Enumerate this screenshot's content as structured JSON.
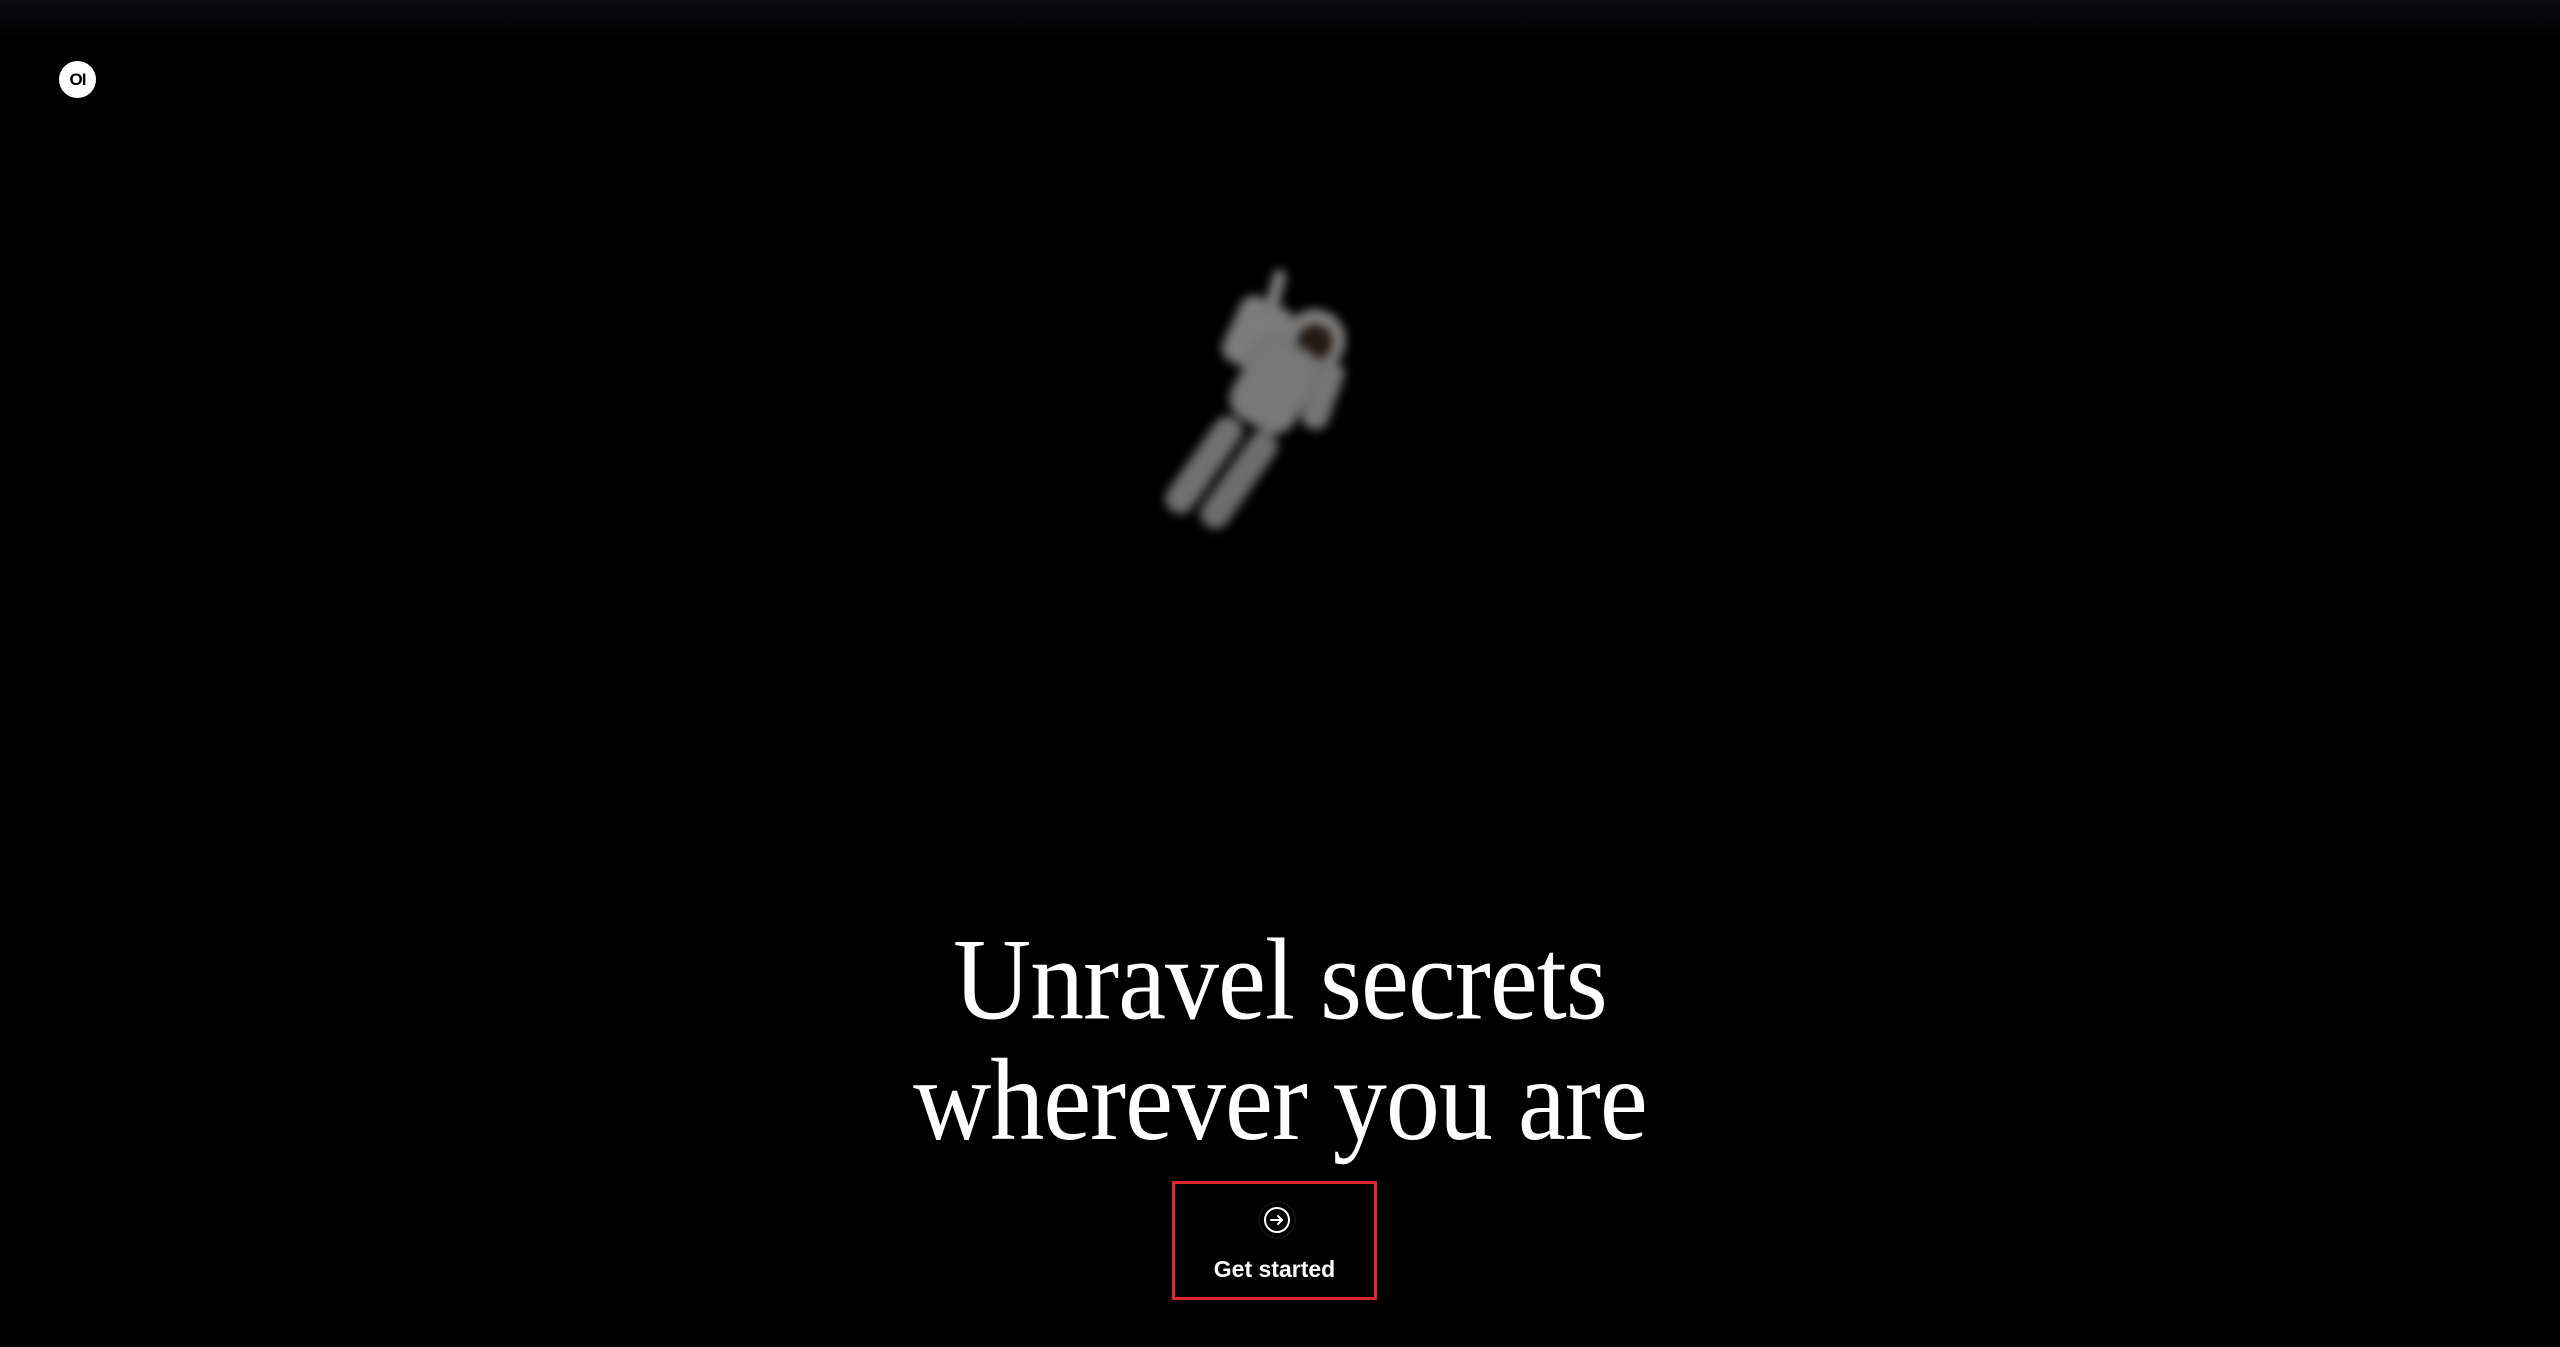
{
  "brand": {
    "logo_text": "OI",
    "logo_icon": "brand-logo-icon"
  },
  "hero": {
    "image": "astronaut-floating-image",
    "headline_line1": "Unravel secrets",
    "headline_line2": "wherever you are"
  },
  "cta": {
    "label": "Get started",
    "icon": "arrow-right-circle-icon",
    "highlight_color": "#e0262d"
  },
  "colors": {
    "background": "#000000",
    "text": "#ffffff"
  }
}
